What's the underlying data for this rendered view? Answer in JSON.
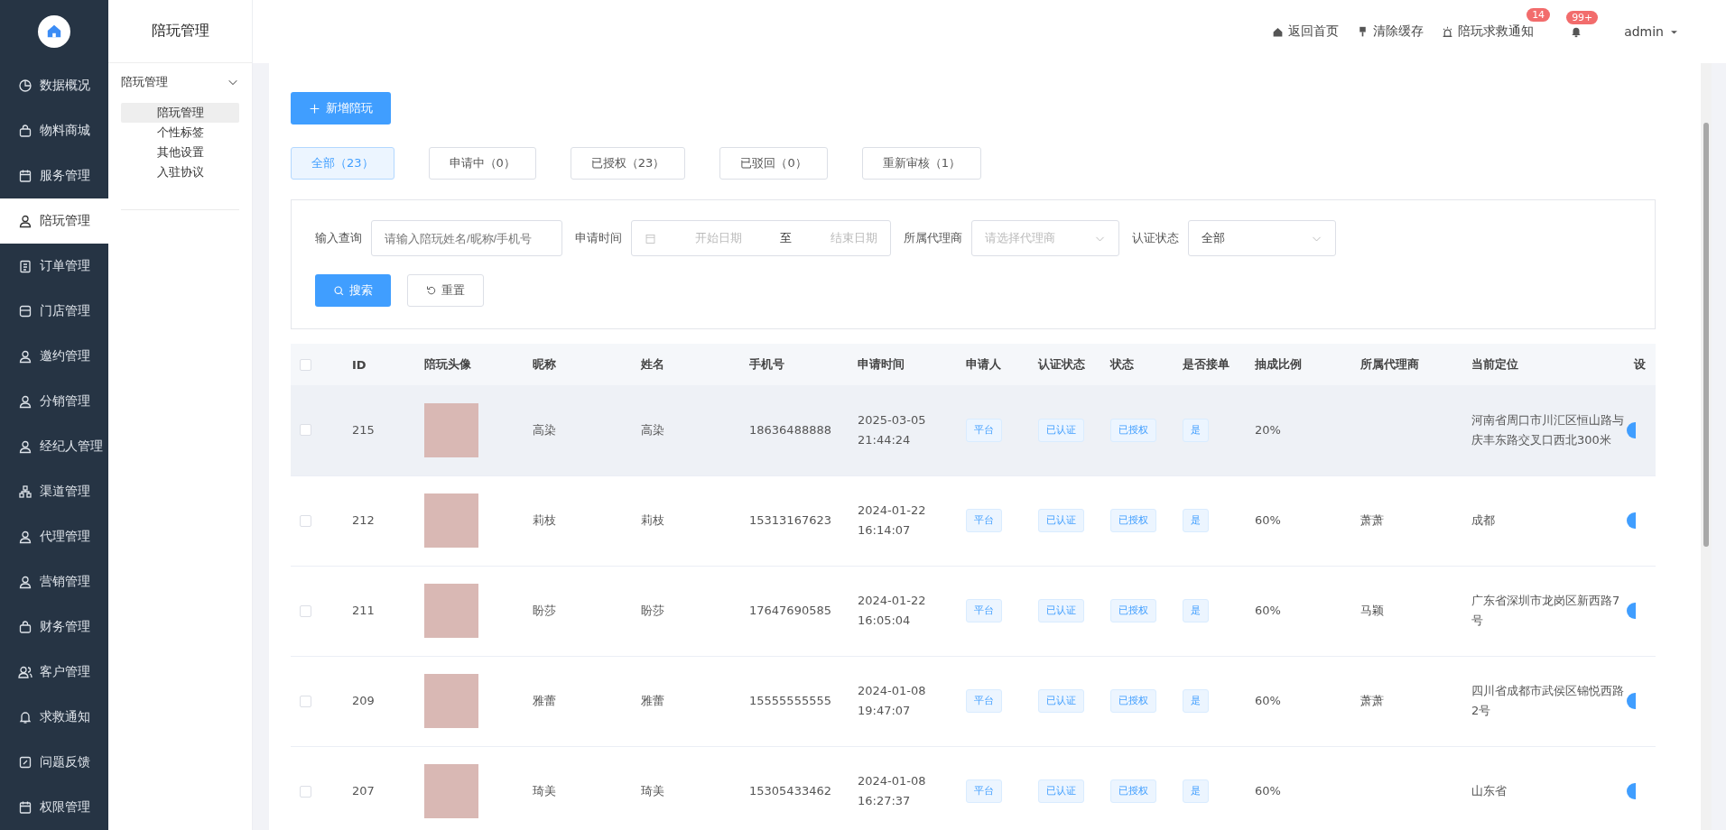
{
  "sidebar": {
    "items": [
      {
        "label": "数据概况",
        "selected": false
      },
      {
        "label": "物料商城",
        "selected": false
      },
      {
        "label": "服务管理",
        "selected": false
      },
      {
        "label": "陪玩管理",
        "selected": true
      },
      {
        "label": "订单管理",
        "selected": false
      },
      {
        "label": "门店管理",
        "selected": false
      },
      {
        "label": "邀约管理",
        "selected": false
      },
      {
        "label": "分销管理",
        "selected": false
      },
      {
        "label": "经纪人管理",
        "selected": false
      },
      {
        "label": "渠道管理",
        "selected": false
      },
      {
        "label": "代理管理",
        "selected": false
      },
      {
        "label": "营销管理",
        "selected": false
      },
      {
        "label": "财务管理",
        "selected": false
      },
      {
        "label": "客户管理",
        "selected": false
      },
      {
        "label": "求救通知",
        "selected": false
      },
      {
        "label": "问题反馈",
        "selected": false
      },
      {
        "label": "权限管理",
        "selected": false
      }
    ]
  },
  "submenu": {
    "title": "陪玩管理",
    "group": {
      "label": "陪玩管理",
      "expanded": true,
      "items": [
        {
          "label": "陪玩管理",
          "selected": true
        },
        {
          "label": "个性标签",
          "selected": false
        },
        {
          "label": "其他设置",
          "selected": false
        },
        {
          "label": "入驻协议",
          "selected": false
        }
      ]
    }
  },
  "topbar": {
    "links": [
      {
        "label": "返回首页"
      },
      {
        "label": "清除缓存"
      },
      {
        "label": "陪玩求救通知",
        "badge": "14"
      }
    ],
    "notifications": {
      "badge": "99+"
    },
    "user": "admin"
  },
  "add_button": "新增陪玩",
  "status_tabs": [
    {
      "label": "全部（23）",
      "selected": true
    },
    {
      "label": "申请中（0）",
      "selected": false
    },
    {
      "label": "已授权（23）",
      "selected": false
    },
    {
      "label": "已驳回（0）",
      "selected": false
    },
    {
      "label": "重新审核（1）",
      "selected": false
    }
  ],
  "filters": {
    "query": {
      "label": "输入查询",
      "placeholder": "请输入陪玩姓名/昵称/手机号"
    },
    "date": {
      "label": "申请时间",
      "start_placeholder": "开始日期",
      "separator": "至",
      "end_placeholder": "结束日期"
    },
    "agent": {
      "label": "所属代理商",
      "placeholder": "请选择代理商"
    },
    "auth": {
      "label": "认证状态",
      "value": "全部"
    },
    "search_button": "搜索",
    "reset_button": "重置"
  },
  "table": {
    "select_all_checked": false,
    "columns": [
      "ID",
      "陪玩头像",
      "昵称",
      "姓名",
      "手机号",
      "申请时间",
      "申请人",
      "认证状态",
      "状态",
      "是否接单",
      "抽成比例",
      "所属代理商",
      "当前定位",
      "设"
    ],
    "rows": [
      {
        "checked": false,
        "hover": true,
        "id": "215",
        "nickname": "高染",
        "name": "高染",
        "phone": "18636488888",
        "time": [
          "2025-03-05",
          "21:44:24"
        ],
        "applicant": "平台",
        "auth": "已认证",
        "status": "已授权",
        "accept": "是",
        "rate": "20%",
        "agent": "",
        "location": "河南省周口市川汇区恒山路与庆丰东路交叉口西北300米",
        "enabled": true
      },
      {
        "checked": false,
        "hover": false,
        "id": "212",
        "nickname": "莉枝",
        "name": "莉枝",
        "phone": "15313167623",
        "time": [
          "2024-01-22",
          "16:14:07"
        ],
        "applicant": "平台",
        "auth": "已认证",
        "status": "已授权",
        "accept": "是",
        "rate": "60%",
        "agent": "萧萧",
        "location": "成都",
        "enabled": true
      },
      {
        "checked": false,
        "hover": false,
        "id": "211",
        "nickname": "盼莎",
        "name": "盼莎",
        "phone": "17647690585",
        "time": [
          "2024-01-22",
          "16:05:04"
        ],
        "applicant": "平台",
        "auth": "已认证",
        "status": "已授权",
        "accept": "是",
        "rate": "60%",
        "agent": "马颖",
        "location": "广东省深圳市龙岗区新西路7号",
        "enabled": true
      },
      {
        "checked": false,
        "hover": false,
        "id": "209",
        "nickname": "雅蕾",
        "name": "雅蕾",
        "phone": "15555555555",
        "time": [
          "2024-01-08",
          "19:47:07"
        ],
        "applicant": "平台",
        "auth": "已认证",
        "status": "已授权",
        "accept": "是",
        "rate": "60%",
        "agent": "萧萧",
        "location": "四川省成都市武侯区锦悦西路2号",
        "enabled": true
      },
      {
        "checked": false,
        "hover": false,
        "id": "207",
        "nickname": "琦美",
        "name": "琦美",
        "phone": "15305433462",
        "time": [
          "2024-01-08",
          "16:27:37"
        ],
        "applicant": "平台",
        "auth": "已认证",
        "status": "已授权",
        "accept": "是",
        "rate": "60%",
        "agent": "",
        "location": "山东省",
        "enabled": true
      }
    ]
  }
}
